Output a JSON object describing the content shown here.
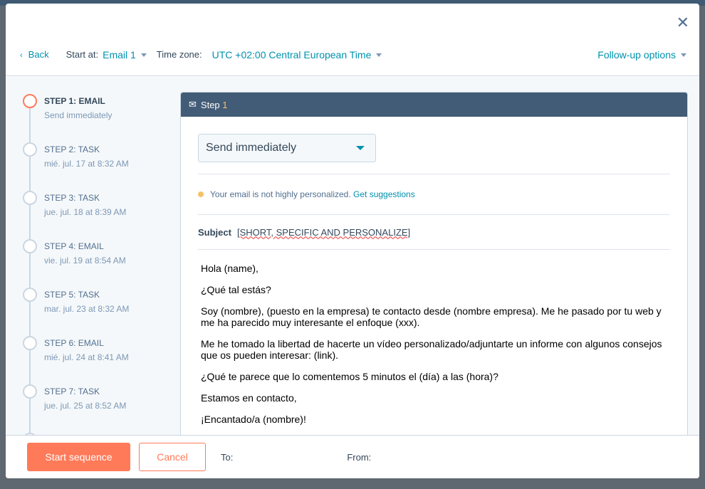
{
  "header": {
    "back": "Back",
    "start_at_label": "Start at:",
    "start_at_value": "Email 1",
    "timezone_label": "Time zone:",
    "timezone_value": "UTC +02:00 Central European Time",
    "followup": "Follow-up options"
  },
  "steps": [
    {
      "title": "STEP 1: EMAIL",
      "date": "Send immediately"
    },
    {
      "title": "STEP 2: TASK",
      "date": "mié. jul. 17 at 8:32 AM"
    },
    {
      "title": "STEP 3: TASK",
      "date": "jue. jul. 18 at 8:39 AM"
    },
    {
      "title": "STEP 4: EMAIL",
      "date": "vie. jul. 19 at 8:54 AM"
    },
    {
      "title": "STEP 5: TASK",
      "date": "mar. jul. 23 at 8:32 AM"
    },
    {
      "title": "STEP 6: EMAIL",
      "date": "mié. jul. 24 at 8:41 AM"
    },
    {
      "title": "STEP 7: TASK",
      "date": "jue. jul. 25 at 8:52 AM"
    }
  ],
  "card": {
    "title_prefix": "Step",
    "title_num": "1",
    "send_option": "Send immediately",
    "warning": "Your email is not highly personalized.",
    "suggestions": "Get suggestions",
    "subject_label": "Subject",
    "subject_value": "[SHORT, SPECIFIC AND PERSONALIZE]",
    "body": [
      "Hola (name),",
      "¿Qué tal estás?",
      "Soy (nombre), (puesto en la empresa) te contacto desde  (nombre empresa). Me he pasado por tu web y me ha parecido muy interesante el enfoque (xxx).",
      "Me he tomado la libertad de hacerte un vídeo personalizado/adjuntarte un informe con algunos consejos que os pueden interesar: (link).",
      "¿Qué te parece que lo comentemos  5 minutos el (día) a las (hora)?",
      "Estamos en contacto,",
      "¡Encantado/a (nombre)!"
    ]
  },
  "footer": {
    "start": "Start sequence",
    "cancel": "Cancel",
    "to": "To:",
    "from": "From:"
  },
  "colors": {
    "accent": "#ff7a59",
    "link": "#0091ae",
    "header": "#425b76"
  }
}
